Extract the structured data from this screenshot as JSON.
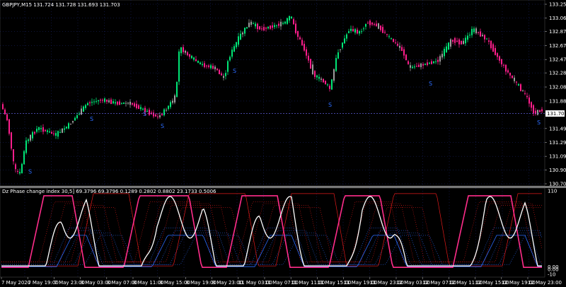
{
  "main_chart": {
    "header": "GBPJPY,M15  131.724 131.728 131.693 131.703",
    "current_price": "131.703",
    "y_ticks": [
      "133.255",
      "133.060",
      "132.870",
      "132.670",
      "132.470",
      "132.280",
      "132.080",
      "131.880",
      "131.703",
      "131.490",
      "131.290",
      "131.095",
      "130.900",
      "130.705"
    ],
    "y_min": 130.705,
    "y_max": 133.255,
    "current_value": 131.703,
    "colors": {
      "bull": "#00e676",
      "bear": "#ff1e8c",
      "neutral": "#9e9e9e",
      "grid": "#1e2a78",
      "marker": "#2b6bff"
    },
    "marker_label": "S"
  },
  "indicator": {
    "header": "Dz Phase change index 30,5] 69.3796 69.3796 0.1289 0.2802 0.8802 23.1733 0.5006",
    "y_ticks": [
      "110",
      "0.00",
      "0.00",
      "-10"
    ],
    "colors": {
      "main_bull": "#00e676",
      "main_bear": "#ff2d8a",
      "white": "#ffffff",
      "red": "#e11a1a",
      "blue": "#2d6cff",
      "purple": "#b26bd1"
    }
  },
  "time_axis": {
    "labels": [
      "7 May 2020",
      "7 May 19:00",
      "7 May 23:00",
      "8 May 03:00",
      "8 May 07:00",
      "8 May 11:00",
      "8 May 15:00",
      "8 May 19:00",
      "8 May 23:00",
      "11 May 03:00",
      "11 May 07:00",
      "11 May 11:00",
      "11 May 15:00",
      "11 May 19:00",
      "11 May 23:00",
      "12 May 03:00",
      "12 May 07:00",
      "12 May 11:00",
      "12 May 15:00",
      "12 May 19:00",
      "12 May 23:00"
    ]
  }
}
